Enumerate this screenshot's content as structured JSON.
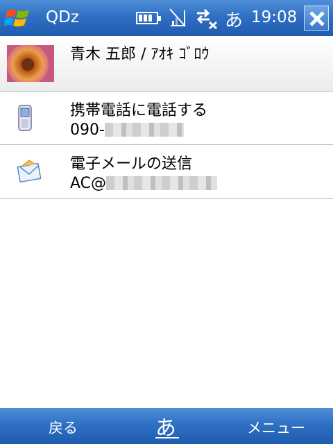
{
  "titlebar": {
    "app_title": "QDz",
    "ime_indicator": "あ",
    "time": "19:08",
    "icons": [
      "windows-logo",
      "battery-icon",
      "no-signal-icon",
      "connectivity-icon",
      "close-icon"
    ]
  },
  "contact": {
    "name": "青木 五郎 / ｱｵｷ ｺﾞﾛｳ",
    "photo": "flower-photo"
  },
  "actions": [
    {
      "label": "携帯電話に電話する",
      "value_prefix": "090-",
      "icon": "mobile-phone-icon"
    },
    {
      "label": "電子メールの送信",
      "value_prefix": "AC@",
      "icon": "envelope-icon"
    }
  ],
  "softkeys": {
    "left": "戻る",
    "center": "あ",
    "right": "メニュー"
  },
  "colors": {
    "bar_blue": "#2f6fc4",
    "divider": "#a9bfd6"
  }
}
